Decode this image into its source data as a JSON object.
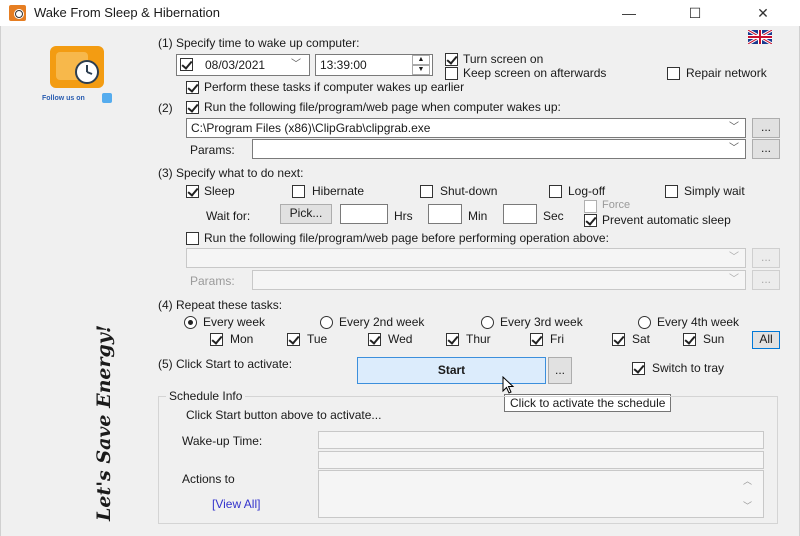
{
  "window": {
    "title": "Wake From Sleep & Hibernation",
    "minimize": "—",
    "maximize": "☐",
    "close": "✕"
  },
  "sidebar": {
    "follow_text": "Follow us on",
    "slogan": "Let's Save Energy!"
  },
  "step1": {
    "label": "(1) Specify time to wake up computer:",
    "date": "08/03/2021",
    "time": "13:39:00",
    "turn_screen_on": "Turn screen on",
    "keep_screen_on": "Keep screen on afterwards",
    "repair_network": "Repair network",
    "perform_earlier": "Perform these tasks if computer wakes up earlier"
  },
  "step2": {
    "label": "Run the following file/program/web page when computer wakes up:",
    "number": "(2)",
    "path": "C:\\Program Files (x86)\\ClipGrab\\clipgrab.exe",
    "params_label": "Params:",
    "params_value": "",
    "browse": "..."
  },
  "step3": {
    "label": "(3) Specify what to do next:",
    "options": [
      "Sleep",
      "Hibernate",
      "Shut-down",
      "Log-off",
      "Simply wait"
    ],
    "wait_for": "Wait for:",
    "pick": "Pick...",
    "hrs": "Hrs",
    "min": "Min",
    "sec": "Sec",
    "force": "Force",
    "prevent_sleep": "Prevent automatic sleep",
    "run_before": "Run the following file/program/web page before performing operation above:",
    "params_label": "Params:",
    "browse": "..."
  },
  "step4": {
    "label": "(4) Repeat these tasks:",
    "frequency": [
      "Every week",
      "Every 2nd week",
      "Every 3rd week",
      "Every 4th week"
    ],
    "days": [
      "Mon",
      "Tue",
      "Wed",
      "Thur",
      "Fri",
      "Sat",
      "Sun"
    ],
    "all": "All"
  },
  "step5": {
    "label": "(5) Click Start to activate:",
    "start": "Start",
    "more": "...",
    "switch_tray": "Switch to tray",
    "tooltip": "Click to activate the schedule"
  },
  "schedule": {
    "title": "Schedule Info",
    "hint": "Click Start button above to activate...",
    "wake_time": "Wake-up Time:",
    "actions": "Actions to",
    "view_all": "[View All]"
  },
  "colors": {
    "accent": "#0078d7",
    "link": "#3333cc",
    "start_bg": "#dcecfc",
    "logo_orange": "#f39c12"
  }
}
